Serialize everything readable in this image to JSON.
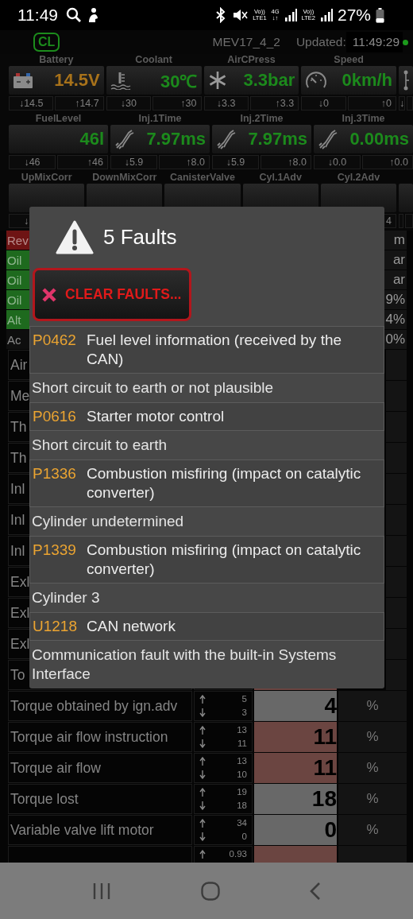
{
  "status_bar": {
    "time": "11:49",
    "sim1": {
      "top": "Vo))",
      "bottom": "LTE1"
    },
    "network": {
      "top": "4G",
      "bottom": "↓↑"
    },
    "sim2": {
      "top": "Vo))",
      "bottom": "LTE2"
    },
    "battery": "27%"
  },
  "header": {
    "logo": "CL",
    "ecu": "MEV17_4_2",
    "updated_label": "Updated:",
    "updated_time": "11:49:29",
    "connected": true
  },
  "gauge_rows": [
    {
      "gauges": [
        {
          "kind": "battery",
          "label": "Battery",
          "value": "14.5V",
          "warn": true,
          "min": "↓14.5",
          "max": "↑14.7"
        },
        {
          "kind": "thermometer",
          "label": "Coolant",
          "value": "30℃",
          "warn": false,
          "min": "↓30",
          "max": "↑30"
        },
        {
          "kind": "snowflake",
          "label": "AirCPress",
          "value": "3.3bar",
          "warn": false,
          "min": "↓3.3",
          "max": "↑3.3"
        },
        {
          "kind": "speedometer",
          "label": "Speed",
          "value": "0km/h",
          "warn": false,
          "min": "↓0",
          "max": "↑0"
        },
        {
          "kind": "slider",
          "min": "↓"
        }
      ]
    },
    {
      "gauges": [
        {
          "kind": "plain",
          "label": "FuelLevel",
          "value": "46l",
          "warn": false,
          "min": "↓46",
          "max": "↑46"
        },
        {
          "kind": "injector",
          "label": "Inj.1Time",
          "value": "7.97ms",
          "warn": false,
          "min": "↓5.9",
          "max": "↑8.0"
        },
        {
          "kind": "injector",
          "label": "Inj.2Time",
          "value": "7.97ms",
          "warn": false,
          "min": "↓5.9",
          "max": "↑8.0"
        },
        {
          "kind": "injector",
          "label": "Inj.3Time",
          "value": "0.00ms",
          "warn": false,
          "min": "↓0.0",
          "max": "↑0.0"
        }
      ]
    },
    {
      "gauges": [
        {
          "kind": "plain",
          "label": "UpMixCorr",
          "min": "↓"
        },
        {
          "kind": "plain",
          "label": "DownMixCorr"
        },
        {
          "kind": "plain",
          "label": "CanisterValve"
        },
        {
          "kind": "plain",
          "label": "Cyl.1Adv"
        },
        {
          "kind": "plain",
          "label": "Cyl.2Adv",
          "max": "4"
        },
        {
          "kind": "blank"
        }
      ]
    }
  ],
  "table": {
    "rows": [
      {
        "kind": "status",
        "name": "Rev",
        "tail": "m",
        "color": "#6e1414"
      },
      {
        "kind": "status",
        "name": "Oil",
        "tail": "ar",
        "color": "#1e6a1e"
      },
      {
        "kind": "status",
        "name": "Oil",
        "tail": "ar",
        "color": "#1e6a1e"
      },
      {
        "kind": "status",
        "name": "Oil",
        "tail": "9%",
        "color": "#1e6a1e"
      },
      {
        "kind": "status",
        "name": "Alt",
        "tail": "4%",
        "color": "#1e6a1e"
      },
      {
        "kind": "status",
        "name": "Ac",
        "tail": "0%",
        "color": "#0e0e0e"
      },
      {
        "kind": "data",
        "name": "Air"
      },
      {
        "kind": "data",
        "name": "Me"
      },
      {
        "kind": "data",
        "name": "Th"
      },
      {
        "kind": "data",
        "name": "Th"
      },
      {
        "kind": "data",
        "name": "Inl"
      },
      {
        "kind": "data",
        "name": "Inl"
      },
      {
        "kind": "data",
        "name": "Inl"
      },
      {
        "kind": "data",
        "name": "Exl"
      },
      {
        "kind": "data",
        "name": "Exl"
      },
      {
        "kind": "data",
        "name": "Exl"
      },
      {
        "kind": "data",
        "name": "To",
        "alert": true
      },
      {
        "kind": "data",
        "name": "Torque obtained by ign.adv",
        "max": "5",
        "min": "3",
        "value": "4",
        "unit": "%",
        "alert": false
      },
      {
        "kind": "data",
        "name": "Torque air flow instruction",
        "max": "13",
        "min": "11",
        "value": "11",
        "unit": "%",
        "alert": true
      },
      {
        "kind": "data",
        "name": "Torque air flow",
        "max": "13",
        "min": "10",
        "value": "11",
        "unit": "%",
        "alert": true
      },
      {
        "kind": "data",
        "name": "Torque lost",
        "max": "19",
        "min": "18",
        "value": "18",
        "unit": "%",
        "alert": false
      },
      {
        "kind": "data",
        "name": "Variable valve lift motor",
        "max": "34",
        "min": "0",
        "value": "0",
        "unit": "%",
        "alert": false
      },
      {
        "kind": "data",
        "max": "0.93",
        "alert": true
      }
    ]
  },
  "dialog": {
    "title": "5 Faults",
    "clear_button": "CLEAR FAULTS...",
    "faults": [
      {
        "code": "P0462",
        "title": "Fuel level information (received by the CAN)",
        "detail": "Short circuit to earth or not plausible"
      },
      {
        "code": "P0616",
        "title": "Starter motor control",
        "detail": "Short circuit to earth"
      },
      {
        "code": "P1336",
        "title": "Combustion misfiring (impact on catalytic converter)",
        "detail": "Cylinder undetermined"
      },
      {
        "code": "P1339",
        "title": "Combustion misfiring (impact on catalytic converter)",
        "detail": "Cylinder 3"
      },
      {
        "code": "U1218",
        "title": "CAN network",
        "detail": "Communication fault with the built-in Systems Interface"
      }
    ]
  }
}
